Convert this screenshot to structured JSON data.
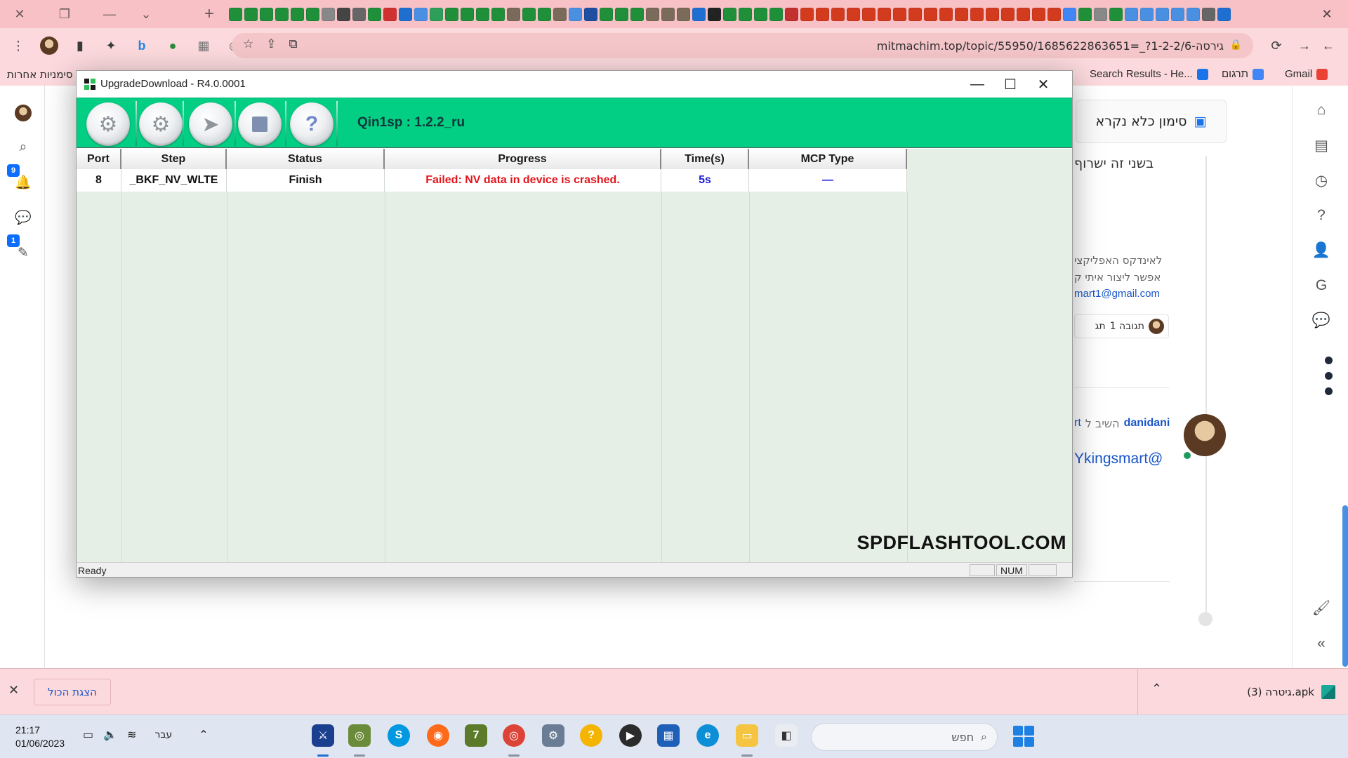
{
  "browser": {
    "url": "mitmachim.top/topic/55950/1685622863651=_?1-2-2/6-גירסה",
    "bookmarks": [
      {
        "label": "Gmail",
        "color": "#ea4335"
      },
      {
        "label": "תרגום",
        "color": "#4285f4"
      },
      {
        "label": "Search Results - He...",
        "color": "#1a73e8"
      },
      {
        "label": "סימניות אחרות",
        "color": "#f5b400"
      }
    ],
    "tab_icon_colors": [
      "#1f8f3a",
      "#1f8f3a",
      "#1f8f3a",
      "#1f8f3a",
      "#1f8f3a",
      "#1f8f3a",
      "#888888",
      "#444444",
      "#666666",
      "#1f8f3a",
      "#d03030",
      "#1f6fd0",
      "#4a90e2",
      "#2e9f5a",
      "#1f8f3a",
      "#1f8f3a",
      "#1f8f3a",
      "#1f8f3a",
      "#7a6a5a",
      "#1f8f3a",
      "#1f8f3a",
      "#7a6a5a",
      "#4a90e2",
      "#1f4fa0",
      "#1f8f3a",
      "#1f8f3a",
      "#1f8f3a",
      "#7a6a5a",
      "#7a6a5a",
      "#7a6a5a",
      "#1f6fd0",
      "#222222",
      "#1f8f3a",
      "#1f8f3a",
      "#1f8f3a",
      "#1f8f3a",
      "#c23030",
      "#d33b1f",
      "#d33b1f",
      "#d33b1f",
      "#d33b1f",
      "#d33b1f",
      "#d33b1f",
      "#d33b1f",
      "#d33b1f",
      "#d33b1f",
      "#d33b1f",
      "#d33b1f",
      "#d33b1f",
      "#d33b1f",
      "#d33b1f",
      "#d33b1f",
      "#d33b1f",
      "#d33b1f",
      "#4285f4",
      "#1f8f3a",
      "#888888",
      "#1f8f3a",
      "#4a90e2",
      "#4a90e2",
      "#4a90e2",
      "#4a90e2",
      "#4a90e2",
      "#666666",
      "#1f6fd0"
    ]
  },
  "app": {
    "title": "UpgradeDownload - R4.0.0001",
    "device_version": "Qin1sp : 1.2.2_ru",
    "columns": [
      "Port",
      "Step",
      "Status",
      "Progress",
      "Time(s)",
      "MCP Type"
    ],
    "rows": [
      {
        "port": "8",
        "step": "_BKF_NV_WLTE",
        "status": "Finish",
        "progress": "Failed: NV data in device is crashed.",
        "time": "5s",
        "mcp": "—"
      }
    ],
    "watermark": "SPDFLASHTOOL.COM",
    "status_text": "Ready",
    "status_num": "NUM",
    "colors": {
      "toolbar": "#02cf83",
      "error": "#e3141b",
      "time": "#1a1ad6"
    }
  },
  "page": {
    "mark_read": "סימון כלא נקרא",
    "post_line1": "בשני זה ישרוף",
    "post_line2": "לאינדקס האפליקצי",
    "post_line3": "אפשר ליצור איתי ק",
    "post_email": "mart1@gmail.com",
    "reply_count": "תגובה 1",
    "reply_count_tail": "תג",
    "reply_user": "danidani",
    "reply_to": "השיב ל",
    "reply_to_tail": "rt",
    "mention": "Ykingsmart@",
    "badge_notifications": "9",
    "badge_chat": "1"
  },
  "downloads": {
    "file": "גיטרה (3).apk",
    "show_all": "הצגת הכול"
  },
  "taskbar": {
    "time": "21:17",
    "date": "01/06/2023",
    "lang": "עבר",
    "search_placeholder": "חפש"
  }
}
